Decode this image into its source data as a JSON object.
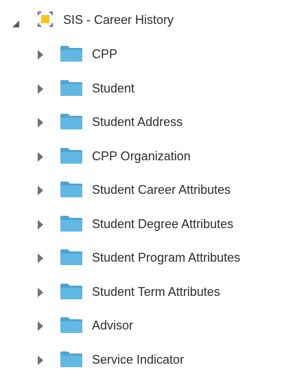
{
  "tree": {
    "root": {
      "label": "SIS - Career History",
      "expanded": true,
      "icon": "subject-area-icon"
    },
    "children": [
      {
        "label": "CPP",
        "icon": "folder-icon",
        "expanded": false
      },
      {
        "label": "Student",
        "icon": "folder-icon",
        "expanded": false
      },
      {
        "label": "Student Address",
        "icon": "folder-icon",
        "expanded": false
      },
      {
        "label": "CPP Organization",
        "icon": "folder-icon",
        "expanded": false
      },
      {
        "label": "Student Career Attributes",
        "icon": "folder-icon",
        "expanded": false
      },
      {
        "label": "Student Degree Attributes",
        "icon": "folder-icon",
        "expanded": false
      },
      {
        "label": "Student Program Attributes",
        "icon": "folder-icon",
        "expanded": false
      },
      {
        "label": "Student Term Attributes",
        "icon": "folder-icon",
        "expanded": false
      },
      {
        "label": "Advisor",
        "icon": "folder-icon",
        "expanded": false
      },
      {
        "label": "Service Indicator",
        "icon": "folder-icon",
        "expanded": false
      }
    ]
  },
  "colors": {
    "text": "#2d2d2d",
    "folder": "#63b8e3",
    "folder_tab": "#4fa3d2",
    "subject_icon_gold": "#f5c518",
    "subject_icon_frame": "#7b6cae"
  }
}
